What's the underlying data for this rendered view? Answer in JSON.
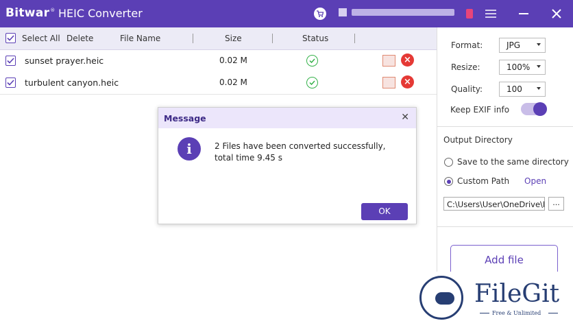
{
  "titlebar": {
    "brand": "Bitwar",
    "brand_mark": "®",
    "app_title": "HEIC Converter",
    "icons": [
      "cart-icon",
      "gift-icon",
      "menu-icon",
      "minimize-icon",
      "close-icon"
    ],
    "colors": {
      "bar": "#5b3fb5"
    }
  },
  "table": {
    "select_all_label": "Select All",
    "delete_label": "Delete",
    "columns": {
      "file_name": "File Name",
      "size": "Size",
      "status": "Status"
    },
    "rows": [
      {
        "name": "sunset prayer.heic",
        "size": "0.02 M",
        "status": "check-circle-icon"
      },
      {
        "name": "turbulent canyon.heic",
        "size": "0.02 M",
        "status": "check-circle-icon"
      }
    ]
  },
  "settings": {
    "format_label": "Format:",
    "format_value": "JPG",
    "resize_label": "Resize:",
    "resize_value": "100%",
    "quality_label": "Quality:",
    "quality_value": "100",
    "exif_label": "Keep EXIF info",
    "exif_enabled": true
  },
  "output": {
    "heading": "Output Directory",
    "same_dir_label": "Save to the same directory",
    "custom_label": "Custom Path",
    "open_link": "Open",
    "path_value": "C:\\Users\\User\\OneDrive\\D",
    "browse_label": "...",
    "add_file_label": "Add file"
  },
  "dialog": {
    "title": "Message",
    "close_glyph": "✕",
    "icon_glyph": "i",
    "message": "2 Files have been converted successfully, total time 9.45 s",
    "ok_label": "OK"
  },
  "watermark": {
    "name": "FileGit",
    "tagline": "Free & Unlimited"
  }
}
